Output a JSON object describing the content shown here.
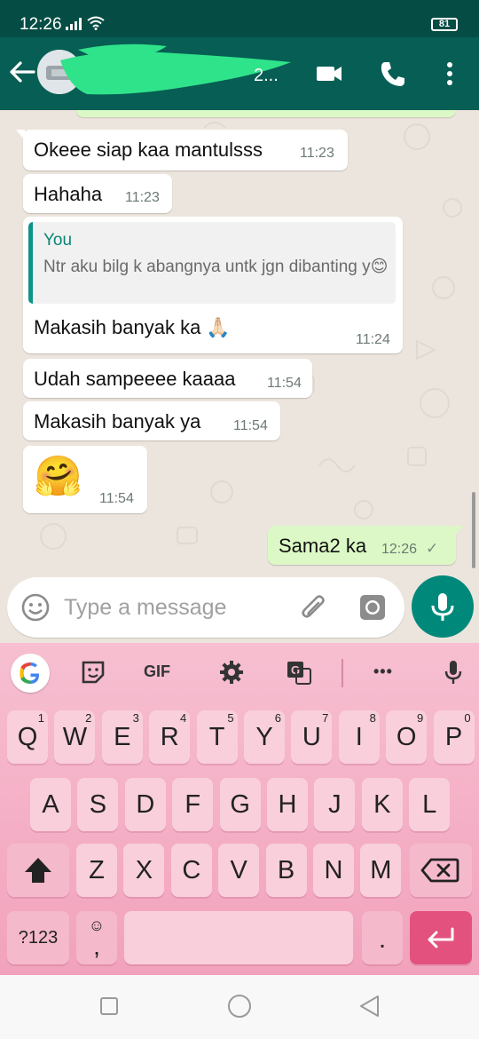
{
  "status_bar": {
    "time": "12:26",
    "battery": "81"
  },
  "header": {
    "contact_name_visible": "2..."
  },
  "messages": [
    {
      "dir": "in",
      "text": "Okeee siap kaa mantulsss",
      "time": "11:23"
    },
    {
      "dir": "in",
      "text": "Hahaha",
      "time": "11:23"
    },
    {
      "dir": "in",
      "quote_author": "You",
      "quote_text": "Ntr aku bilg k abangnya untk jgn dibanting y😊",
      "text": "Makasih banyak ka 🙏🏻",
      "time": "11:24"
    },
    {
      "dir": "in",
      "text": "Udah sampeeee kaaaa",
      "time": "11:54"
    },
    {
      "dir": "in",
      "text": "Makasih banyak ya",
      "time": "11:54"
    },
    {
      "dir": "in",
      "text": "🤗",
      "time": "11:54"
    },
    {
      "dir": "out",
      "text": "Sama2 ka",
      "time": "12:26",
      "status": "✓"
    }
  ],
  "composer": {
    "placeholder": "Type a message"
  },
  "keyboard": {
    "toolbar": {
      "gif": "GIF",
      "more": "•••"
    },
    "row1": [
      {
        "k": "Q",
        "h": "1"
      },
      {
        "k": "W",
        "h": "2"
      },
      {
        "k": "E",
        "h": "3"
      },
      {
        "k": "R",
        "h": "4"
      },
      {
        "k": "T",
        "h": "5"
      },
      {
        "k": "Y",
        "h": "6"
      },
      {
        "k": "U",
        "h": "7"
      },
      {
        "k": "I",
        "h": "8"
      },
      {
        "k": "O",
        "h": "9"
      },
      {
        "k": "P",
        "h": "0"
      }
    ],
    "row2": [
      "A",
      "S",
      "D",
      "F",
      "G",
      "H",
      "J",
      "K",
      "L"
    ],
    "row3": [
      "Z",
      "X",
      "C",
      "V",
      "B",
      "N",
      "M"
    ],
    "symbols": "?123",
    "emoji": "☺",
    "comma": ",",
    "period": "."
  },
  "colors": {
    "header": "#075e54",
    "accent": "#00897b",
    "outgoing": "#dcf8c6",
    "keyboard": "#f7bfd1",
    "enter": "#e3527f"
  }
}
